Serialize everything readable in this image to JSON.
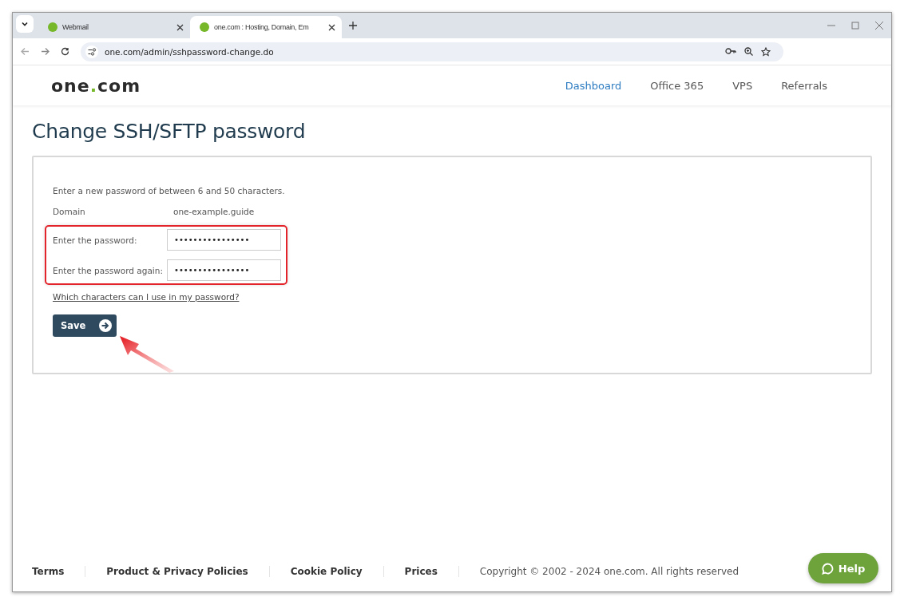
{
  "browser": {
    "tabs": [
      {
        "title": "Webmail",
        "selected": false
      },
      {
        "title": "one.com : Hosting, Domain, Em",
        "selected": true
      }
    ],
    "address": "one.com/admin/sshpassword-change.do"
  },
  "header": {
    "logo": {
      "before": "one",
      "dot": ".",
      "after": "com"
    },
    "nav": [
      {
        "label": "Dashboard",
        "selected": true
      },
      {
        "label": "Office 365",
        "selected": false
      },
      {
        "label": "VPS",
        "selected": false
      },
      {
        "label": "Referrals",
        "selected": false
      }
    ]
  },
  "title": "Change SSH/SFTP password",
  "form": {
    "intro": "Enter a new password of between 6 and 50 characters.",
    "domain_label": "Domain",
    "domain_value": "one-example.guide",
    "fields": [
      {
        "label": "Enter the password:",
        "value": "••••••••••••••••"
      },
      {
        "label": "Enter the password again:",
        "value": "••••••••••••••••"
      }
    ],
    "help_link": "Which characters can I use in my password?",
    "save": "Save"
  },
  "footer": {
    "links": [
      "Terms",
      "Product & Privacy Policies",
      "Cookie Policy",
      "Prices"
    ],
    "copyright": "Copyright © 2002 - 2024 one.com. All rights reserved"
  },
  "help_button": "Help"
}
